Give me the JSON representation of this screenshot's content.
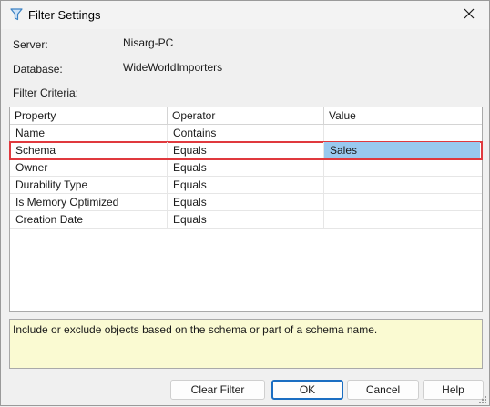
{
  "window": {
    "title": "Filter Settings"
  },
  "fields": {
    "server_label": "Server:",
    "server_value": "Nisarg-PC",
    "database_label": "Database:",
    "database_value": "WideWorldImporters",
    "criteria_label": "Filter Criteria:"
  },
  "grid": {
    "columns": [
      "Property",
      "Operator",
      "Value"
    ],
    "rows": [
      {
        "property": "Name",
        "operator": "Contains",
        "value": ""
      },
      {
        "property": "Schema",
        "operator": "Equals",
        "value": "Sales"
      },
      {
        "property": "Owner",
        "operator": "Equals",
        "value": ""
      },
      {
        "property": "Durability Type",
        "operator": "Equals",
        "value": ""
      },
      {
        "property": "Is Memory Optimized",
        "operator": "Equals",
        "value": ""
      },
      {
        "property": "Creation Date",
        "operator": "Equals",
        "value": ""
      }
    ]
  },
  "description": "Include or exclude objects based on the schema or part of a schema name.",
  "buttons": {
    "clear_filter": "Clear Filter",
    "ok": "OK",
    "cancel": "Cancel",
    "help": "Help"
  },
  "icons": {
    "title": "filter-funnel-icon",
    "close": "close-icon",
    "grip": "resize-grip-icon"
  },
  "colors": {
    "highlight_outline": "#e0393e",
    "selected_value_bg": "#99c9ef",
    "description_bg": "#fafad2",
    "primary_border": "#1b6ec2",
    "funnel_icon": "#3b82c4"
  }
}
